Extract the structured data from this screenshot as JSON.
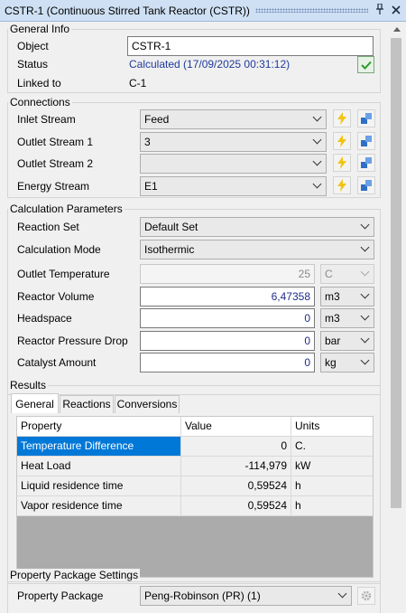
{
  "window": {
    "title": "CSTR-1 (Continuous Stirred Tank Reactor (CSTR))",
    "pin_icon": "pin-icon",
    "close_icon": "close-icon"
  },
  "general_info": {
    "title": "General Info",
    "object_label": "Object",
    "object_value": "CSTR-1",
    "status_label": "Status",
    "status_value": "Calculated (17/09/2025 00:31:12)",
    "linked_label": "Linked to",
    "linked_value": "C-1"
  },
  "connections": {
    "title": "Connections",
    "rows": [
      {
        "label": "Inlet Stream",
        "value": "Feed"
      },
      {
        "label": "Outlet Stream 1",
        "value": "3"
      },
      {
        "label": "Outlet Stream 2",
        "value": ""
      },
      {
        "label": "Energy Stream",
        "value": "E1"
      }
    ]
  },
  "calc_params": {
    "title": "Calculation Parameters",
    "reaction_set_label": "Reaction Set",
    "reaction_set_value": "Default Set",
    "calc_mode_label": "Calculation Mode",
    "calc_mode_value": "Isothermic",
    "outlet_temp_label": "Outlet Temperature",
    "outlet_temp_value": "25",
    "outlet_temp_unit": "C",
    "reactor_volume_label": "Reactor Volume",
    "reactor_volume_value": "6,47358",
    "reactor_volume_unit": "m3",
    "headspace_label": "Headspace",
    "headspace_value": "0",
    "headspace_unit": "m3",
    "pressure_drop_label": "Reactor Pressure Drop",
    "pressure_drop_value": "0",
    "pressure_drop_unit": "bar",
    "catalyst_label": "Catalyst Amount",
    "catalyst_value": "0",
    "catalyst_unit": "kg"
  },
  "results": {
    "title": "Results",
    "tabs": [
      "General",
      "Reactions",
      "Conversions"
    ],
    "columns": [
      "Property",
      "Value",
      "Units"
    ],
    "rows": [
      {
        "property": "Temperature Difference",
        "value": "0",
        "units": "C."
      },
      {
        "property": "Heat Load",
        "value": "-114,979",
        "units": "kW"
      },
      {
        "property": "Liquid residence time",
        "value": "0,59524",
        "units": "h"
      },
      {
        "property": "Vapor residence time",
        "value": "0,59524",
        "units": "h"
      }
    ]
  },
  "property_package": {
    "title": "Property Package Settings",
    "label": "Property Package",
    "value": "Peng-Robinson (PR) (1)"
  },
  "colors": {
    "accent": "#0078d7",
    "status_text": "#1f3a9a",
    "titlebar": "#cfe0f4"
  }
}
